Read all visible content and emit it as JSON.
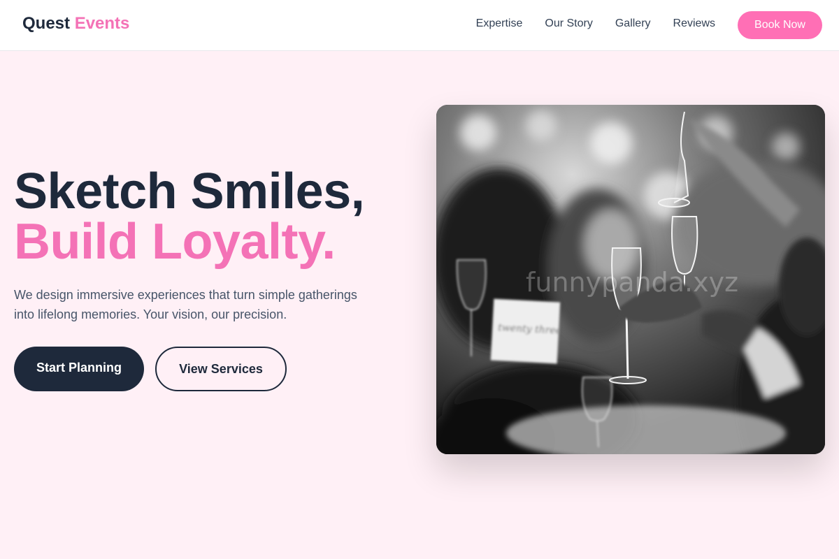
{
  "header": {
    "logo_main": "Quest",
    "logo_accent": "Events",
    "nav": [
      "Expertise",
      "Our Story",
      "Gallery",
      "Reviews"
    ],
    "cta_label": "Book Now"
  },
  "hero": {
    "title_line1": "Sketch Smiles,",
    "title_line2": "Build Loyalty.",
    "subtitle": "We design immersive experiences that turn simple gatherings into lifelong memories. Your vision, our precision.",
    "primary_button": "Start Planning",
    "secondary_button": "View Services",
    "image_card_text": "twenty three",
    "watermark": "funnypanda.xyz"
  },
  "colors": {
    "accent": "#f472b6",
    "accent_button": "#ff6fb5",
    "dark": "#1e293b",
    "background": "#fff0f6"
  }
}
